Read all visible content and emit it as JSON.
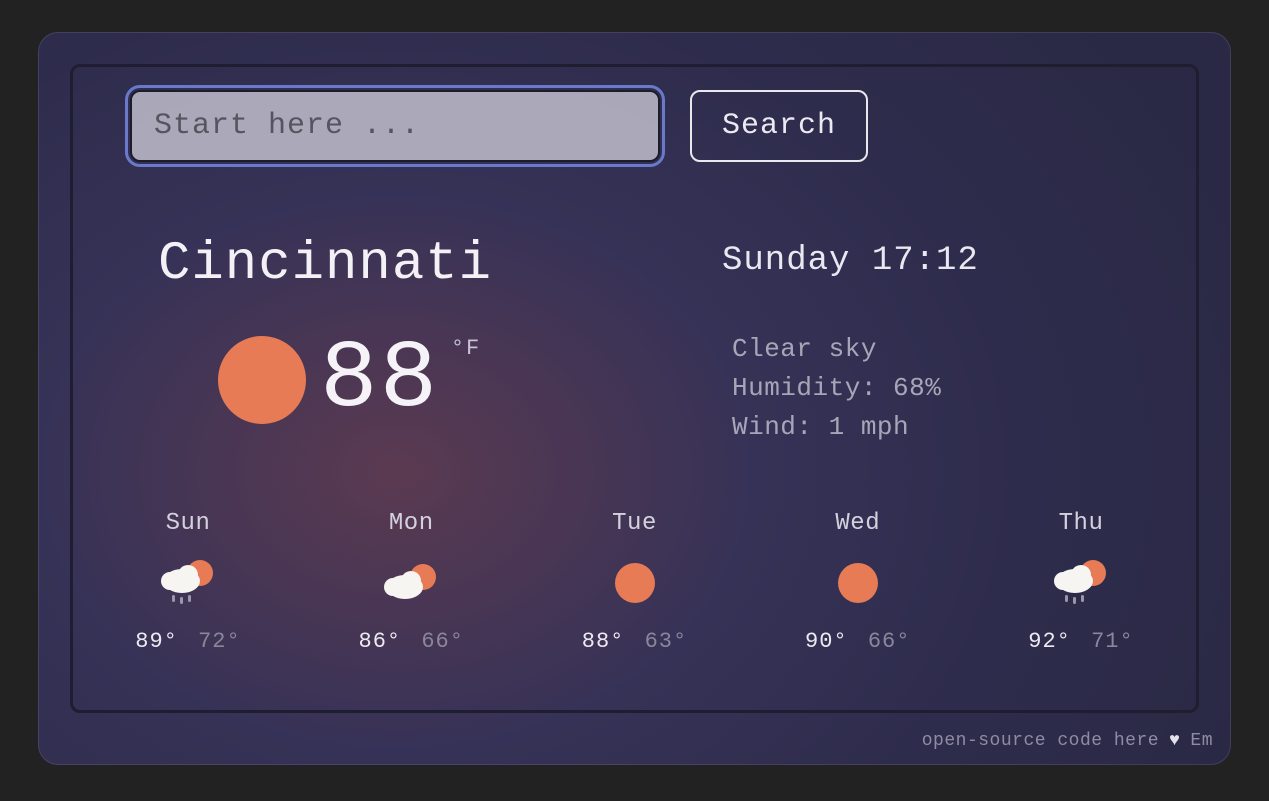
{
  "search": {
    "placeholder": "Start here ...",
    "value": "",
    "button_label": "Search"
  },
  "current": {
    "city": "Cincinnati",
    "datetime": "Sunday 17:12",
    "temp": "88",
    "unit": "°F",
    "description": "Clear sky",
    "humidity_label": "Humidity: 68%",
    "wind_label": "Wind: 1 mph",
    "icon": "clear"
  },
  "forecast": [
    {
      "day": "Sun",
      "icon": "cloud-sun-rain",
      "hi": "89°",
      "lo": "72°"
    },
    {
      "day": "Mon",
      "icon": "cloud-sun",
      "hi": "86°",
      "lo": "66°"
    },
    {
      "day": "Tue",
      "icon": "clear",
      "hi": "88°",
      "lo": "63°"
    },
    {
      "day": "Wed",
      "icon": "clear",
      "hi": "90°",
      "lo": "66°"
    },
    {
      "day": "Thu",
      "icon": "cloud-sun-rain",
      "hi": "92°",
      "lo": "71°"
    }
  ],
  "footer": {
    "link_text": "open-source code here",
    "author": "Em"
  },
  "icons": {
    "heart": "♥"
  }
}
